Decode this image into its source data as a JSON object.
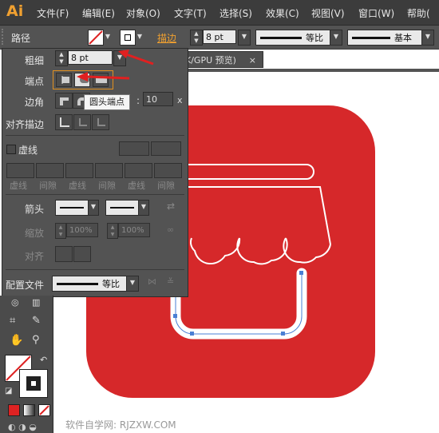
{
  "app": {
    "logo": "Ai"
  },
  "menu": [
    "文件(F)",
    "编辑(E)",
    "对象(O)",
    "文字(T)",
    "选择(S)",
    "效果(C)",
    "视图(V)",
    "窗口(W)",
    "帮助("
  ],
  "control_bar": {
    "panel_name": "路径",
    "stroke_label": "描边",
    "stroke_weight": "8 pt",
    "profile_label": "等比",
    "brush_label": "基本"
  },
  "document_tab": {
    "title": "K/GPU 预览)",
    "close": "×"
  },
  "stroke_panel": {
    "weight_label": "粗细",
    "weight_value": "8 pt",
    "cap_label": "端点",
    "corner_label": "边角",
    "limit_value": "10",
    "limit_suffix": "x",
    "tooltip": "圆头端点",
    "align_label": "对齐描边",
    "dashed_label": "虚线",
    "dash_labels": [
      "虚线",
      "间隙",
      "虚线",
      "间隙",
      "虚线",
      "间隙"
    ],
    "arrow_label": "箭头",
    "scale_label": "缩放",
    "scale_values": [
      "100%",
      "100%"
    ],
    "align_arrow_label": "对齐",
    "profile_label": "配置文件",
    "profile_value": "等比"
  },
  "watermark": "软件自学网: RJZXW.COM",
  "colors": {
    "accent": "#f0a030",
    "icon_red": "#d6282a",
    "panel_bg": "#535353",
    "menubar_bg": "#3c3c3c",
    "arrow_red": "#e02020"
  }
}
